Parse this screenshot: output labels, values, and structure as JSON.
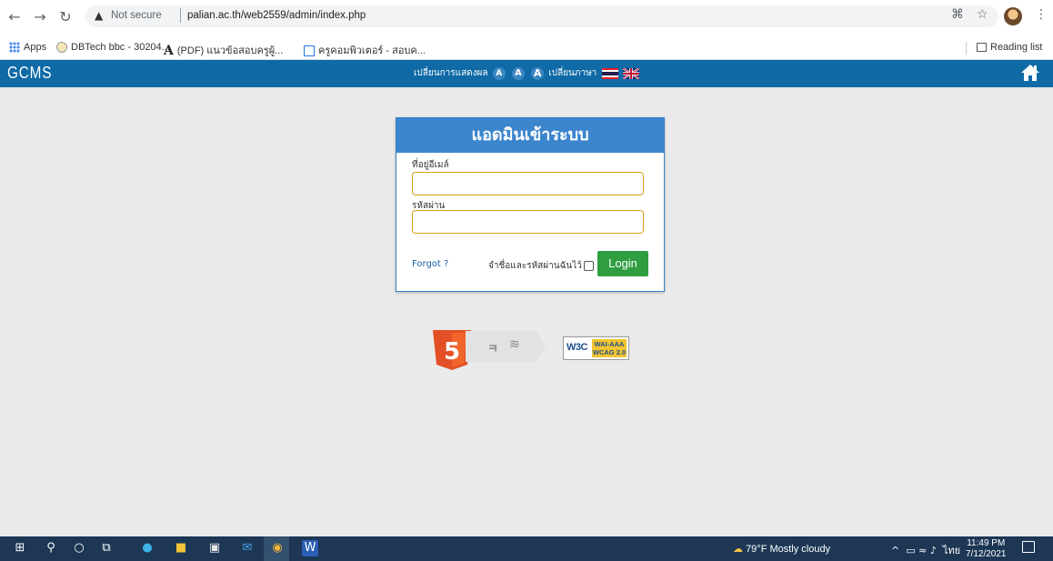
{
  "browser": {
    "security_label": "Not secure",
    "url": "palian.ac.th/web2559/admin/index.php",
    "bookmarks": [
      {
        "label": "Apps"
      },
      {
        "label": "DBTech bbc - 30204..."
      },
      {
        "label": "(PDF) แนวข้อสอบครูผู้..."
      },
      {
        "label": "ครูคอมพิวเตอร์ - สอบค..."
      }
    ],
    "reading_list": "Reading list"
  },
  "site": {
    "logo": "GCMS",
    "display_label": "เปลี่ยนการแสดงผล",
    "font_sizes": [
      "A",
      "A",
      "A"
    ],
    "language_label": "เปลี่ยนภาษา"
  },
  "login": {
    "title": "แอดมินเข้าระบบ",
    "email_label": "ที่อยู่อีเมล์",
    "email_value": "",
    "password_label": "รหัสผ่าน",
    "password_value": "",
    "forgot": "Forgot ?",
    "remember": "จำชื่อและรหัสผ่านฉันไว้",
    "remember_checked": false,
    "submit": "Login"
  },
  "badges": {
    "html5_glyph": "5",
    "wcag_brand": "W3C",
    "wcag_level": "WAI-AAA",
    "wcag_version": "WCAG 2.0"
  },
  "taskbar": {
    "weather": "79°F  Mostly cloudy",
    "lang": "ไทย",
    "time": "11:49 PM",
    "date": "7/12/2021"
  },
  "colors": {
    "header": "#0f6aa6",
    "login_header": "#3b85cd",
    "login_button": "#2f9e41",
    "taskbar": "#1d3755"
  }
}
